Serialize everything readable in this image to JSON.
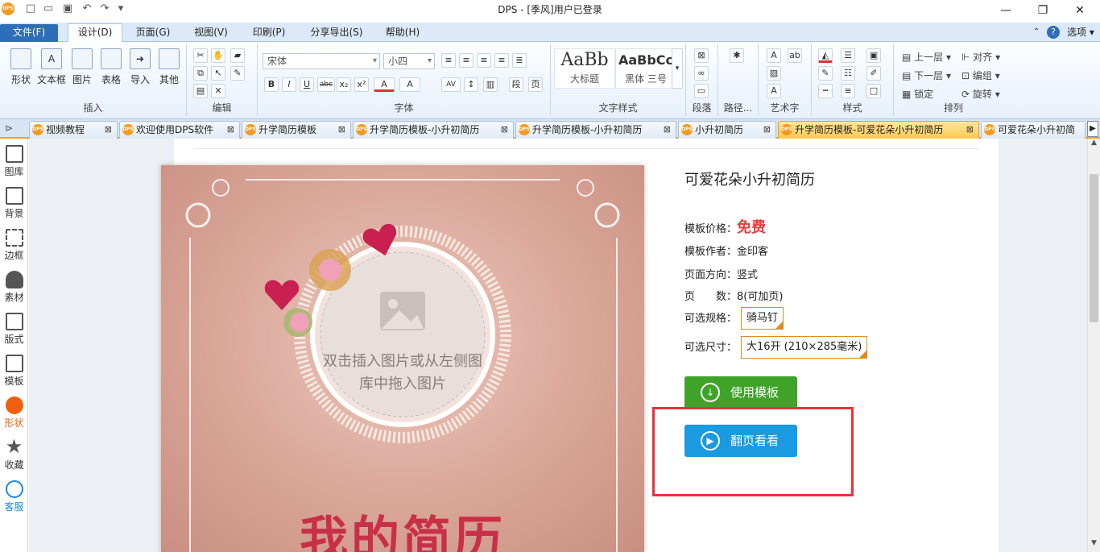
{
  "window": {
    "title": "DPS - [季风]用户已登录"
  },
  "menu": {
    "file": "文件(F)",
    "design": "设计(D)",
    "page": "页面(G)",
    "view": "视图(V)",
    "print": "印刷(P)",
    "share": "分享导出(S)",
    "help": "帮助(H)",
    "options": "选项"
  },
  "ribbon": {
    "insert": {
      "label": "插入",
      "buttons": [
        "形状",
        "文本框",
        "图片",
        "表格",
        "导入",
        "其他"
      ]
    },
    "edit": {
      "label": "编辑"
    },
    "font": {
      "label": "字体",
      "font_name": "宋体",
      "font_size": "小四",
      "bold": "B",
      "italic": "I",
      "underline": "U",
      "strike": "abc",
      "sub": "x₂",
      "sup": "x²"
    },
    "text_style": {
      "label": "文字样式",
      "sample1": "AaBb",
      "name1": "大标题",
      "sample2": "AaBbCc",
      "name2": "黑体 三号"
    },
    "paragraph": {
      "label": "段落"
    },
    "path": {
      "label": "路径..."
    },
    "art": {
      "label": "艺术字"
    },
    "style": {
      "label": "样式"
    },
    "arrange": {
      "label": "排列",
      "up": "上一层",
      "down": "下一层",
      "lock": "锁定",
      "align": "对齐",
      "group": "编组",
      "rotate": "旋转"
    }
  },
  "tabs": [
    {
      "label": "视频教程"
    },
    {
      "label": "欢迎使用DPS软件"
    },
    {
      "label": "升学简历模板"
    },
    {
      "label": "升学简历模板-小升初简历"
    },
    {
      "label": "升学简历模板-小升初简历"
    },
    {
      "label": "小升初简历"
    },
    {
      "label": "升学简历模板-可爱花朵小升初简历",
      "active": true
    },
    {
      "label": "可爱花朵小升初简"
    }
  ],
  "sidebar": [
    "图库",
    "背景",
    "边框",
    "素材",
    "版式",
    "模板",
    "形状",
    "收藏",
    "客服"
  ],
  "template": {
    "title": "可爱花朵小升初简历",
    "price_label": "模板价格：",
    "price_value": "免费",
    "author_label": "模板作者：",
    "author_value": "金印客",
    "orientation_label": "页面方向：",
    "orientation_value": "竖式",
    "pages_label": "页　　数：",
    "pages_value": "8(可加页)",
    "spec_label": "可选规格：",
    "spec_value": "骑马钉",
    "size_label": "可选尺寸：",
    "size_value": "大16开 (210×285毫米)",
    "use_button": "使用模板",
    "flip_button": "翻页看看"
  },
  "preview": {
    "placeholder": "双击插入图片或从左侧图库中拖入图片",
    "heading": "我的简历"
  },
  "colors": {
    "accent": "#2e6db9",
    "price": "#e83c3c",
    "use_btn": "#3fa32a",
    "flip_btn": "#1a9ae0",
    "highlight": "#e8323c"
  }
}
